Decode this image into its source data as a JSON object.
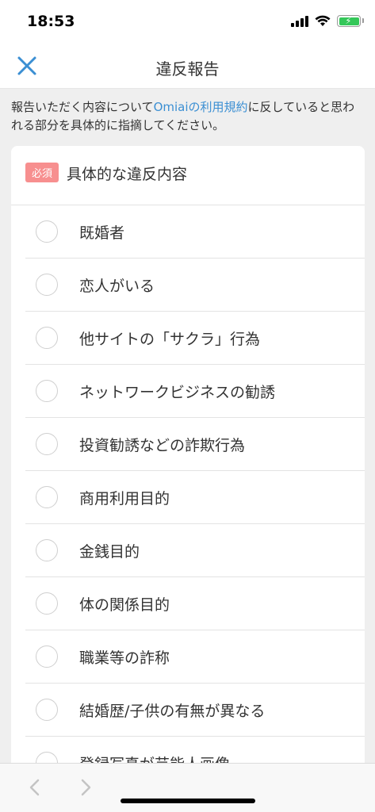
{
  "status_bar": {
    "time": "18:53"
  },
  "nav": {
    "title": "違反報告",
    "close_icon": "close-icon",
    "accent_color": "#3b8fd3"
  },
  "intro": {
    "text_before": "報告いただく内容について",
    "link_text": "Omiaiの利用規約",
    "text_after": "に反していると思われる部分を具体的に指摘してください。"
  },
  "form": {
    "required_badge": "必須",
    "badge_color": "#f78f8f",
    "section_title": "具体的な違反内容",
    "options": [
      "既婚者",
      "恋人がいる",
      "他サイトの「サクラ」行為",
      "ネットワークビジネスの勧誘",
      "投資勧誘などの詐欺行為",
      "商用利用目的",
      "金銭目的",
      "体の関係目的",
      "職業等の詐称",
      "結婚歴/子供の有無が異なる",
      "登録写真が芸能人画像"
    ]
  },
  "toolbar": {
    "back_icon": "chevron-left-icon",
    "forward_icon": "chevron-right-icon"
  }
}
